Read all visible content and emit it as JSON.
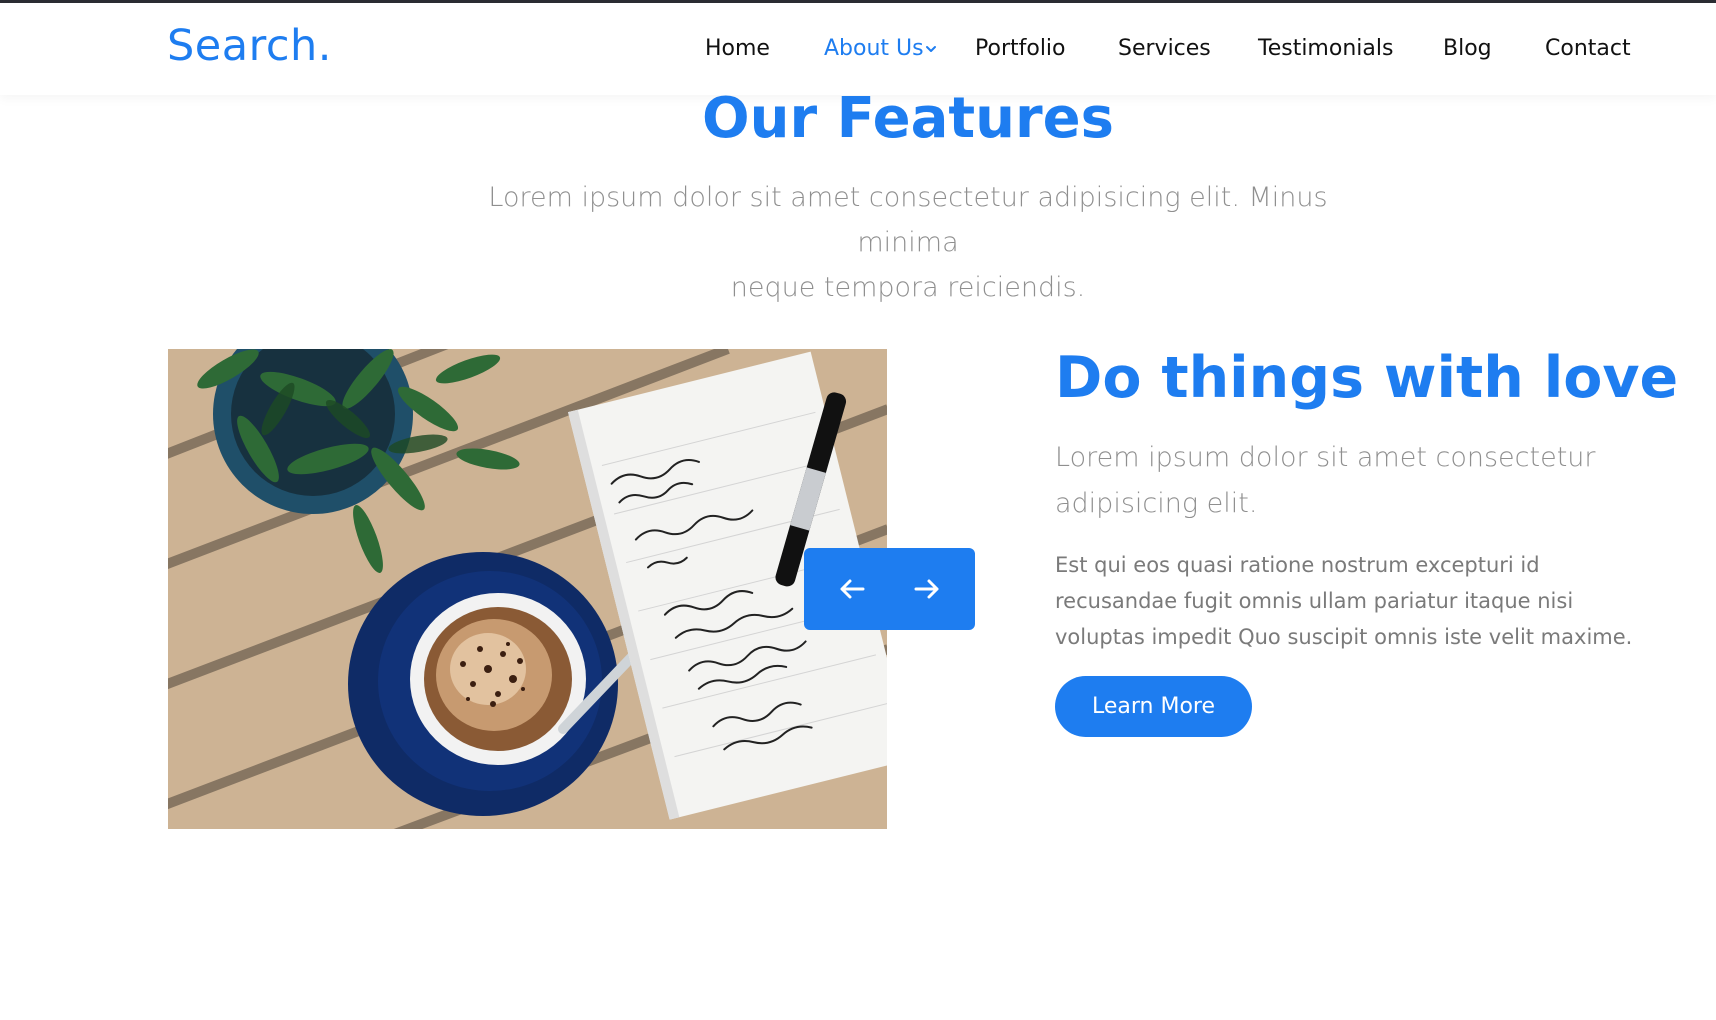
{
  "brand": {
    "logo": "Search."
  },
  "nav": {
    "items": [
      {
        "label": "Home"
      },
      {
        "label": "About Us",
        "active": true,
        "has_dropdown": true
      },
      {
        "label": "Portfolio"
      },
      {
        "label": "Services"
      },
      {
        "label": "Testimonials"
      },
      {
        "label": "Blog"
      },
      {
        "label": "Contact"
      }
    ]
  },
  "features": {
    "title": "Our Features",
    "subtitle_line1": "Lorem ipsum dolor sit amet consectetur adipisicing elit. Minus minima",
    "subtitle_line2": "neque tempora reiciendis."
  },
  "slider": {
    "image_icon": "coffee-notebook-photo",
    "prev_icon": "arrow-left-icon",
    "next_icon": "arrow-right-icon"
  },
  "feature_item": {
    "title": "Do things with love",
    "lead": "Lorem ipsum dolor sit amet consectetur adipisicing elit.",
    "body": "Est qui eos quasi ratione nostrum excepturi id recusandae fugit omnis ullam pariatur itaque nisi voluptas impedit Quo suscipit omnis iste velit maxime.",
    "button_label": "Learn More"
  },
  "colors": {
    "accent": "#1e7df0",
    "text_dark": "#111111",
    "text_muted": "#8f8f8f"
  }
}
